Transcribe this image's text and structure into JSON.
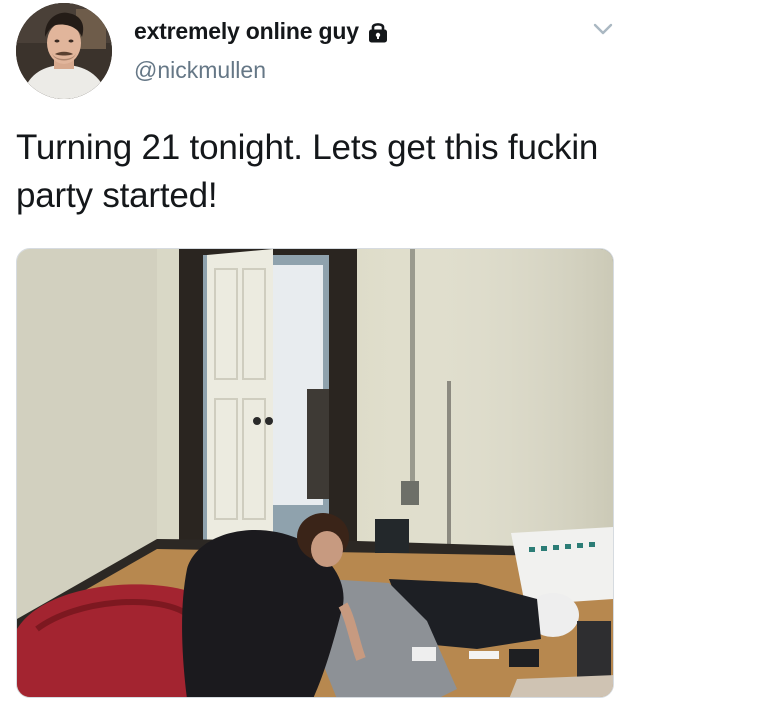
{
  "tweet": {
    "display_name": "extremely online guy",
    "handle": "@nickmullen",
    "protected": true,
    "text": "Turning 21 tonight. Lets get this fuckin party started!",
    "icons": {
      "lock": "lock-icon",
      "menu": "chevron-down-icon"
    },
    "colors": {
      "name": "#14171a",
      "handle": "#657786",
      "chevron": "#aab8c2"
    }
  }
}
